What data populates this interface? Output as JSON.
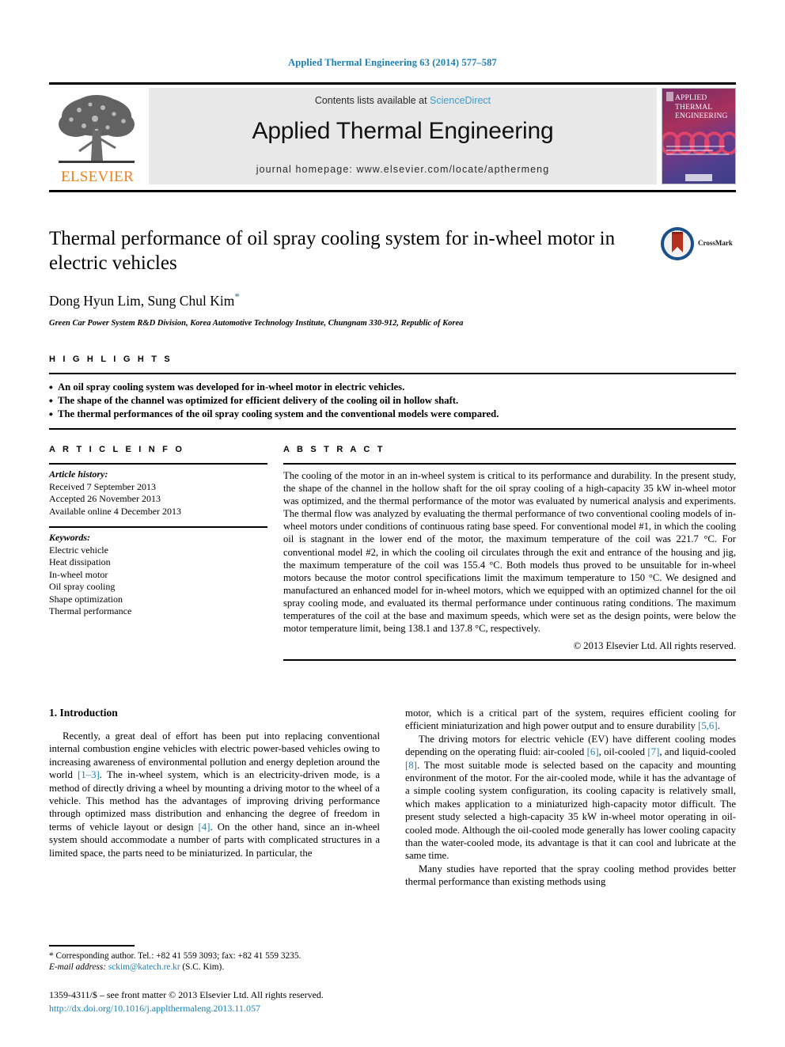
{
  "running_head": "Applied Thermal Engineering 63 (2014) 577–587",
  "masthead": {
    "publisher_name": "ELSEVIER",
    "publisher_logo": "elsevier-tree-logo",
    "contents_prefix": "Contents lists available at ",
    "contents_link": "ScienceDirect",
    "journal_title": "Applied Thermal Engineering",
    "homepage_line": "journal homepage: www.elsevier.com/locate/apthermeng",
    "cover": {
      "line1": "APPLIED",
      "line2": "THERMAL",
      "line3": "ENGINEERING"
    }
  },
  "article": {
    "title": "Thermal performance of oil spray cooling system for in-wheel motor in electric vehicles",
    "authors": "Dong Hyun Lim, Sung Chul Kim",
    "corresponding_marker": "*",
    "affiliation": "Green Car Power System R&D Division, Korea Automotive Technology Institute, Chungnam 330-912, Republic of Korea",
    "crossmark_label": "CrossMark"
  },
  "highlights": {
    "heading": "H I G H L I G H T S",
    "items": [
      "An oil spray cooling system was developed for in-wheel motor in electric vehicles.",
      "The shape of the channel was optimized for efficient delivery of the cooling oil in hollow shaft.",
      "The thermal performances of the oil spray cooling system and the conventional models were compared."
    ]
  },
  "article_info": {
    "heading": "A R T I C L E    I N F O",
    "history_label": "Article history:",
    "history": [
      "Received 7 September 2013",
      "Accepted 26 November 2013",
      "Available online 4 December 2013"
    ],
    "keywords_label": "Keywords:",
    "keywords": [
      "Electric vehicle",
      "Heat dissipation",
      "In-wheel motor",
      "Oil spray cooling",
      "Shape optimization",
      "Thermal performance"
    ]
  },
  "abstract": {
    "heading": "A B S T R A C T",
    "text": "The cooling of the motor in an in-wheel system is critical to its performance and durability. In the present study, the shape of the channel in the hollow shaft for the oil spray cooling of a high-capacity 35 kW in-wheel motor was optimized, and the thermal performance of the motor was evaluated by numerical analysis and experiments. The thermal flow was analyzed by evaluating the thermal performance of two conventional cooling models of in-wheel motors under conditions of continuous rating base speed. For conventional model #1, in which the cooling oil is stagnant in the lower end of the motor, the maximum temperature of the coil was 221.7 °C. For conventional model #2, in which the cooling oil circulates through the exit and entrance of the housing and jig, the maximum temperature of the coil was 155.4 °C. Both models thus proved to be unsuitable for in-wheel motors because the motor control specifications limit the maximum temperature to 150 °C. We designed and manufactured an enhanced model for in-wheel motors, which we equipped with an optimized channel for the oil spray cooling mode, and evaluated its thermal performance under continuous rating conditions. The maximum temperatures of the coil at the base and maximum speeds, which were set as the design points, were below the motor temperature limit, being 138.1 and 137.8 °C, respectively.",
    "copyright": "© 2013 Elsevier Ltd. All rights reserved."
  },
  "introduction": {
    "section_number_title": "1. Introduction",
    "left_para_1_a": "Recently, a great deal of effort has been put into replacing conventional internal combustion engine vehicles with electric power-based vehicles owing to increasing awareness of environmental pollution and energy depletion around the world ",
    "left_ref_1": "[1–3]",
    "left_para_1_b": ". The in-wheel system, which is an electricity-driven mode, is a method of directly driving a wheel by mounting a driving motor to the wheel of a vehicle. This method has the advantages of improving driving performance through optimized mass distribution and enhancing the degree of freedom in terms of vehicle layout or design ",
    "left_ref_2": "[4]",
    "left_para_1_c": ". On the other hand, since an in-wheel system should accommodate a number of parts with complicated structures in a limited space, the parts need to be miniaturized. In particular, the",
    "right_para_1_a": "motor, which is a critical part of the system, requires efficient cooling for efficient miniaturization and high power output and to ensure durability ",
    "right_ref_1": "[5,6]",
    "right_para_1_b": ".",
    "right_para_2_a": "The driving motors for electric vehicle (EV) have different cooling modes depending on the operating fluid: air-cooled ",
    "right_ref_2": "[6]",
    "right_para_2_b": ", oil-cooled ",
    "right_ref_3": "[7]",
    "right_para_2_c": ", and liquid-cooled ",
    "right_ref_4": "[8]",
    "right_para_2_d": ". The most suitable mode is selected based on the capacity and mounting environment of the motor. For the air-cooled mode, while it has the advantage of a simple cooling system configuration, its cooling capacity is relatively small, which makes application to a miniaturized high-capacity motor difficult. The present study selected a high-capacity 35 kW in-wheel motor operating in oil-cooled mode. Although the oil-cooled mode generally has lower cooling capacity than the water-cooled mode, its advantage is that it can cool and lubricate at the same time.",
    "right_para_3": "Many studies have reported that the spray cooling method provides better thermal performance than existing methods using"
  },
  "footnote": {
    "corresponding": "* Corresponding author. Tel.: +82 41 559 3093; fax: +82 41 559 3235.",
    "email_label": "E-mail address: ",
    "email": "sckim@katech.re.kr",
    "email_suffix": " (S.C. Kim)."
  },
  "page_footer": {
    "line1": "1359-4311/$ – see front matter © 2013 Elsevier Ltd. All rights reserved.",
    "doi": "http://dx.doi.org/10.1016/j.applthermaleng.2013.11.057"
  },
  "colors": {
    "link_blue": "#1a7fb5",
    "sciencedirect_blue": "#3d9cd2",
    "elsevier_orange": "#f07f1a",
    "panel_gray": "#e8e8e8"
  }
}
